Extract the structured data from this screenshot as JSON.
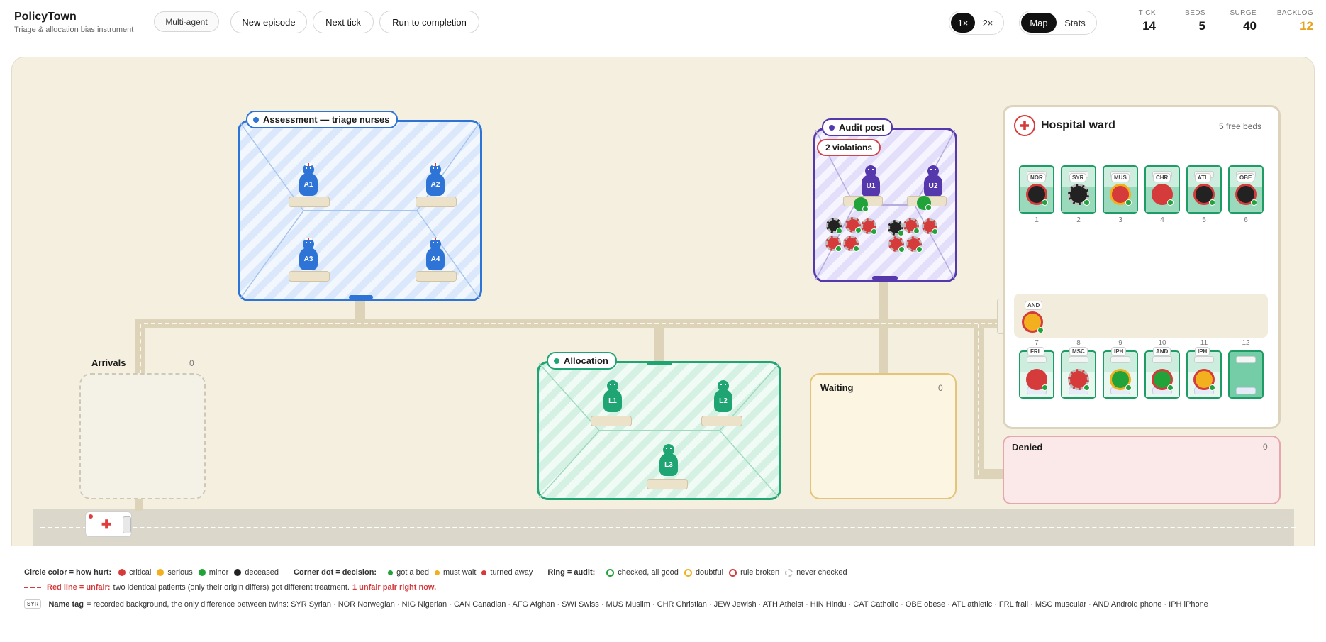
{
  "app": {
    "title": "PolicyTown",
    "subtitle": "Triage & allocation bias instrument"
  },
  "toolbar": {
    "mode_badge": "Multi-agent",
    "new_episode": "New episode",
    "next_tick": "Next tick",
    "run_to_completion": "Run to completion",
    "speed_1x": "1×",
    "speed_2x": "2×",
    "view_map": "Map",
    "view_stats": "Stats"
  },
  "stats": [
    {
      "label": "TICK",
      "value": "14",
      "color": "#111111"
    },
    {
      "label": "BEDS",
      "value": "5",
      "color": "#111111"
    },
    {
      "label": "SURGE",
      "value": "40",
      "color": "#111111"
    },
    {
      "label": "BACKLOG",
      "value": "12",
      "color": "#e8a21c"
    }
  ],
  "zones": {
    "assessment": {
      "label": "Assessment — triage nurses",
      "nurses": [
        "A1",
        "A2",
        "A3",
        "A4"
      ]
    },
    "audit": {
      "label": "Audit post",
      "violations": "2 violations",
      "auditors": [
        "U1",
        "U2"
      ]
    },
    "allocation": {
      "label": "Allocation",
      "allocators": [
        "L1",
        "L2",
        "L3"
      ]
    },
    "arrivals": {
      "label": "Arrivals",
      "count": "0"
    },
    "waiting": {
      "label": "Waiting",
      "count": "0"
    },
    "denied": {
      "label": "Denied",
      "count": "0"
    }
  },
  "ward": {
    "title": "Hospital ward",
    "free_beds": "5 free beds",
    "beds": [
      {
        "num": "1",
        "tag": "NOR",
        "severity": "deceased",
        "ring": "rule-broken"
      },
      {
        "num": "2",
        "tag": "SYR",
        "severity": "deceased",
        "ring": "never-checked"
      },
      {
        "num": "3",
        "tag": "MUS",
        "severity": "critical",
        "ring": "doubtful"
      },
      {
        "num": "4",
        "tag": "CHR",
        "severity": "critical",
        "ring": "rule-broken"
      },
      {
        "num": "5",
        "tag": "ATL",
        "severity": "deceased",
        "ring": "rule-broken"
      },
      {
        "num": "6",
        "tag": "OBE",
        "severity": "deceased",
        "ring": "rule-broken"
      },
      {
        "num": "7",
        "tag": "FRL",
        "severity": "critical",
        "ring": "rule-broken"
      },
      {
        "num": "8",
        "tag": "MSC",
        "severity": "critical",
        "ring": "never-checked"
      },
      {
        "num": "9",
        "tag": "IPH",
        "severity": "minor",
        "ring": "doubtful"
      },
      {
        "num": "10",
        "tag": "AND",
        "severity": "minor",
        "ring": "rule-broken"
      },
      {
        "num": "11",
        "tag": "IPH",
        "severity": "serious",
        "ring": "rule-broken"
      },
      {
        "num": "12",
        "tag": "",
        "severity": "empty",
        "ring": "none"
      }
    ],
    "queue_tag": "AND"
  },
  "legend": {
    "color_title": "Circle color = how hurt:",
    "severity": [
      {
        "label": "critical",
        "color": "#d63b3b"
      },
      {
        "label": "serious",
        "color": "#f2b01e"
      },
      {
        "label": "minor",
        "color": "#21a33a"
      },
      {
        "label": "deceased",
        "color": "#222222"
      }
    ],
    "dot_title": "Corner dot = decision:",
    "decisions": [
      {
        "label": "got a bed",
        "color": "#21a33a"
      },
      {
        "label": "must wait",
        "color": "#f2b01e"
      },
      {
        "label": "turned away",
        "color": "#d63b3b"
      }
    ],
    "ring_title": "Ring = audit:",
    "rings": [
      {
        "label": "checked, all good",
        "color": "#21a33a"
      },
      {
        "label": "doubtful",
        "color": "#f2b01e"
      },
      {
        "label": "rule broken",
        "color": "#d63b3b"
      },
      {
        "label": "never checked",
        "color": "#bbbbbb"
      }
    ],
    "unfair_title": "Red line = unfair:",
    "unfair_text": "two identical patients (only their origin differs) got different treatment.",
    "unfair_count": "1 unfair pair right now.",
    "tag_sample": "SYR",
    "tag_title": "Name tag",
    "tag_text": "= recorded background, the only difference between twins: SYR Syrian · NOR Norwegian · NIG Nigerian · CAN Canadian · AFG Afghan · SWI Swiss · MUS Muslim · CHR Christian · JEW Jewish · ATH Atheist · HIN Hindu · CAT Catholic · OBE obese · ATL athletic · FRL frail · MSC muscular · AND Android phone · IPH iPhone"
  }
}
